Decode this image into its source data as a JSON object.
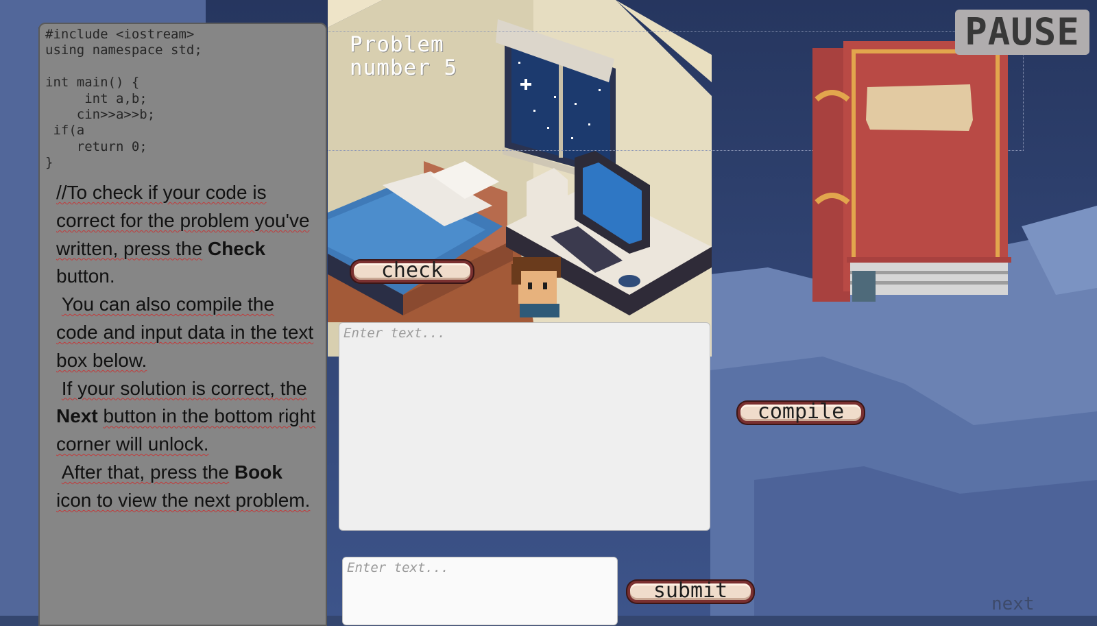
{
  "code_editor": {
    "lines": [
      "#include <iostream>",
      "using namespace std;",
      "",
      "int main() {",
      "     int a,b;",
      "    cin>>a>>b;",
      " if(a",
      "    return 0;",
      "}"
    ]
  },
  "instructions": {
    "p1": "//To check if your code is correct for the problem you've written, press the",
    "p1_bold": "Check",
    "p1_end": "button.",
    "p2": "You can also compile the code and input data in the text box below.",
    "p3_start": "If your solution is correct, the",
    "p3_bold": "Next",
    "p3_end": "button in the bottom right corner will unlock.",
    "p4_start": "After that, press the",
    "p4_bold": "Book",
    "p4_end": "icon to view the next problem."
  },
  "problem": {
    "line1": "Problem",
    "line2": "number 5"
  },
  "buttons": {
    "pause": "PAUSE",
    "check": "check",
    "compile": "compile",
    "submit": "submit",
    "next": "next"
  },
  "inputs": {
    "main_placeholder": "Enter text...",
    "small_placeholder": "Enter text..."
  },
  "icons": {
    "book": "book-icon",
    "character": "character-sprite"
  },
  "colors": {
    "background": "#34466f",
    "panel": "#868686",
    "book_red": "#b94a45",
    "button_border": "#7a3030"
  }
}
